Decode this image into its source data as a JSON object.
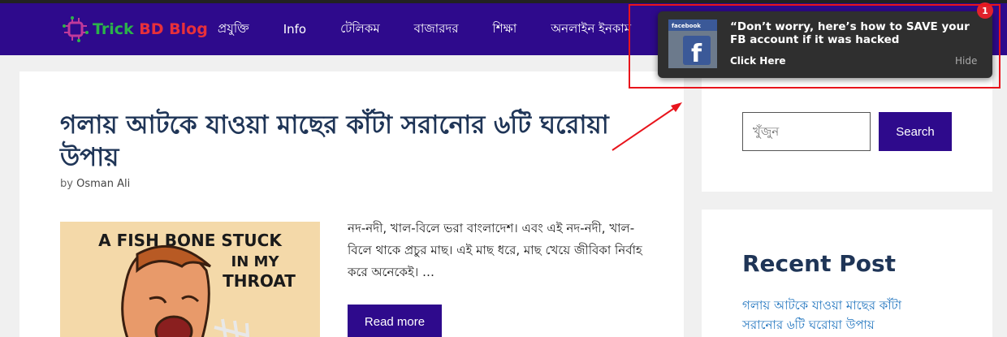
{
  "header": {
    "logo_part1": "Trick",
    "logo_part2": "BD Blog",
    "nav": [
      "প্রযুক্তি",
      "Info",
      "টেলিকম",
      "বাজারদর",
      "শিক্ষা",
      "অনলাইন ইনকাম"
    ]
  },
  "article": {
    "title": "গলায় আটকে যাওয়া মাছের কাঁটা সরানোর ৬টি ঘরোয়া উপায়",
    "by_prefix": "by",
    "author": "Osman Ali",
    "excerpt": "নদ-নদী, খাল-বিলে ভরা বাংলাদেশ। এবং এই নদ-নদী, খাল-বিলে থাকে প্রচুর মাছ। এই মাছ ধরে, মাছ খেয়ে জীবিকা নির্বাহ করে অনেকেই। …",
    "read_more": "Read more",
    "thumb_line1": "A FISH BONE STUCK",
    "thumb_line2": "IN MY",
    "thumb_line3": "THROAT"
  },
  "sidebar": {
    "search_placeholder": "খুঁজুন",
    "search_button": "Search",
    "recent_title": "Recent Post",
    "recent_items": [
      "গলায় আটকে যাওয়া মাছের কাঁটা সরানোর ৬টি ঘরোয়া উপায়"
    ]
  },
  "notification": {
    "message": "“Don’t worry, here’s how to SAVE your FB account if it was hacked",
    "click_label": "Click Here",
    "hide_label": "Hide",
    "badge_count": "1",
    "thumb_label": "facebook"
  },
  "colors": {
    "header_bg": "#2e0a8c",
    "button_bg": "#2e0a8c",
    "title": "#1f3557",
    "link": "#1e73be",
    "highlight": "#e8141c"
  }
}
